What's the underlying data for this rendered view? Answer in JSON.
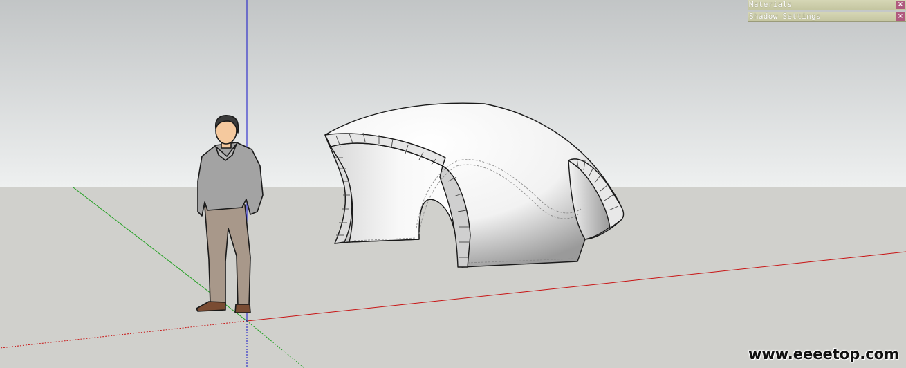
{
  "tray": {
    "panels": [
      {
        "title": "Materials",
        "close": "×"
      },
      {
        "title": "Shadow Settings",
        "close": "×"
      }
    ]
  },
  "scene": {
    "sky_top": "#c2c5c6",
    "sky_bottom": "#eef0f0",
    "ground": "#d0d0cc",
    "axis_red": "#c81414",
    "axis_green": "#22a022",
    "axis_blue": "#1414c8",
    "entities": [
      "scale-figure",
      "shell-structure"
    ]
  },
  "watermark": "www.eeeetop.com"
}
